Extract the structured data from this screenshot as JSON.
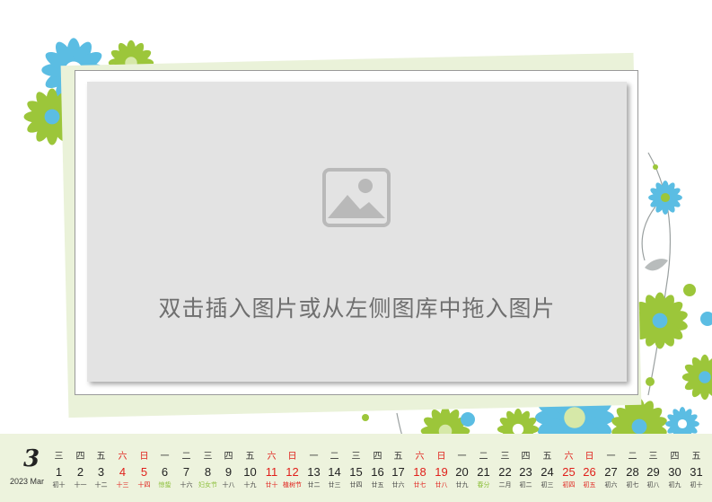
{
  "placeholder": {
    "text": "双击插入图片或从左侧图库中拖入图片",
    "icon": "image-placeholder-icon"
  },
  "calendar": {
    "month_number": "3",
    "month_label": "2023 Mar",
    "days": [
      {
        "weekday": "三",
        "day": "1",
        "lunar": "初十",
        "weekend": false,
        "lunar_style": "normal"
      },
      {
        "weekday": "四",
        "day": "2",
        "lunar": "十一",
        "weekend": false,
        "lunar_style": "normal"
      },
      {
        "weekday": "五",
        "day": "3",
        "lunar": "十二",
        "weekend": false,
        "lunar_style": "normal"
      },
      {
        "weekday": "六",
        "day": "4",
        "lunar": "十三",
        "weekend": true,
        "lunar_style": "red"
      },
      {
        "weekday": "日",
        "day": "5",
        "lunar": "十四",
        "weekend": true,
        "lunar_style": "red"
      },
      {
        "weekday": "一",
        "day": "6",
        "lunar": "惊蛰",
        "weekend": false,
        "lunar_style": "green"
      },
      {
        "weekday": "二",
        "day": "7",
        "lunar": "十六",
        "weekend": false,
        "lunar_style": "normal"
      },
      {
        "weekday": "三",
        "day": "8",
        "lunar": "妇女节",
        "weekend": false,
        "lunar_style": "green"
      },
      {
        "weekday": "四",
        "day": "9",
        "lunar": "十八",
        "weekend": false,
        "lunar_style": "normal"
      },
      {
        "weekday": "五",
        "day": "10",
        "lunar": "十九",
        "weekend": false,
        "lunar_style": "normal"
      },
      {
        "weekday": "六",
        "day": "11",
        "lunar": "廿十",
        "weekend": true,
        "lunar_style": "red"
      },
      {
        "weekday": "日",
        "day": "12",
        "lunar": "植树节",
        "weekend": true,
        "lunar_style": "red"
      },
      {
        "weekday": "一",
        "day": "13",
        "lunar": "廿二",
        "weekend": false,
        "lunar_style": "normal"
      },
      {
        "weekday": "二",
        "day": "14",
        "lunar": "廿三",
        "weekend": false,
        "lunar_style": "normal"
      },
      {
        "weekday": "三",
        "day": "15",
        "lunar": "廿四",
        "weekend": false,
        "lunar_style": "normal"
      },
      {
        "weekday": "四",
        "day": "16",
        "lunar": "廿五",
        "weekend": false,
        "lunar_style": "normal"
      },
      {
        "weekday": "五",
        "day": "17",
        "lunar": "廿六",
        "weekend": false,
        "lunar_style": "normal"
      },
      {
        "weekday": "六",
        "day": "18",
        "lunar": "廿七",
        "weekend": true,
        "lunar_style": "red"
      },
      {
        "weekday": "日",
        "day": "19",
        "lunar": "廿八",
        "weekend": true,
        "lunar_style": "red"
      },
      {
        "weekday": "一",
        "day": "20",
        "lunar": "廿九",
        "weekend": false,
        "lunar_style": "normal"
      },
      {
        "weekday": "二",
        "day": "21",
        "lunar": "春分",
        "weekend": false,
        "lunar_style": "green"
      },
      {
        "weekday": "三",
        "day": "22",
        "lunar": "二月",
        "weekend": false,
        "lunar_style": "normal"
      },
      {
        "weekday": "四",
        "day": "23",
        "lunar": "初二",
        "weekend": false,
        "lunar_style": "normal"
      },
      {
        "weekday": "五",
        "day": "24",
        "lunar": "初三",
        "weekend": false,
        "lunar_style": "normal"
      },
      {
        "weekday": "六",
        "day": "25",
        "lunar": "初四",
        "weekend": true,
        "lunar_style": "red"
      },
      {
        "weekday": "日",
        "day": "26",
        "lunar": "初五",
        "weekend": true,
        "lunar_style": "red"
      },
      {
        "weekday": "一",
        "day": "27",
        "lunar": "初六",
        "weekend": false,
        "lunar_style": "normal"
      },
      {
        "weekday": "二",
        "day": "28",
        "lunar": "初七",
        "weekend": false,
        "lunar_style": "normal"
      },
      {
        "weekday": "三",
        "day": "29",
        "lunar": "初八",
        "weekend": false,
        "lunar_style": "normal"
      },
      {
        "weekday": "四",
        "day": "30",
        "lunar": "初九",
        "weekend": false,
        "lunar_style": "normal"
      },
      {
        "weekday": "五",
        "day": "31",
        "lunar": "初十",
        "weekend": false,
        "lunar_style": "normal"
      }
    ]
  },
  "colors": {
    "weekend_red": "#e0201b",
    "festival_green": "#8cbf3a",
    "flower_blue": "#5bbde3",
    "flower_green": "#9cc63a",
    "strip_bg": "#edf3dd"
  }
}
